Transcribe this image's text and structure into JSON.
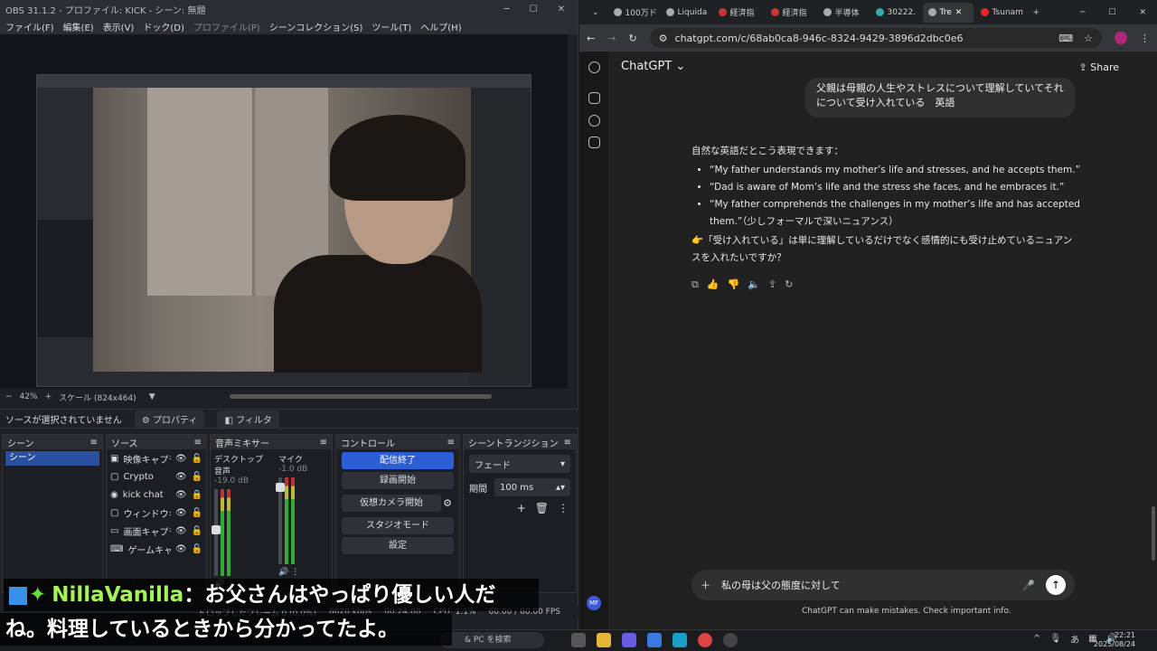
{
  "obs": {
    "title": "OBS 31.1.2 - プロファイル: KICK - シーン: 無題",
    "menu": [
      "ファイル(F)",
      "編集(E)",
      "表示(V)",
      "ドック(D)",
      "プロファイル(P)",
      "シーンコレクション(S)",
      "ツール(T)",
      "ヘルプ(H)"
    ],
    "zoom": "42%",
    "scale": "スケール (824x464)",
    "no_source": "ソースが選択されていません",
    "properties": "プロパティ",
    "filters": "フィルタ",
    "docks": {
      "scenes": {
        "title": "シーン",
        "items": [
          "シーン"
        ]
      },
      "sources": {
        "title": "ソース",
        "items": [
          "映像キャプチャ",
          "Crypto",
          "kick chat",
          "ウィンドウキャプ",
          "画面キャプチャ",
          "ゲームキャプチャ"
        ]
      },
      "mixer": {
        "title": "音声ミキサー",
        "channels": [
          {
            "name": "デスクトップ音声",
            "db": "-19.0 dB"
          },
          {
            "name": "マイク",
            "db": "-1.0 dB"
          }
        ]
      },
      "controls": {
        "title": "コントロール",
        "buttons": [
          "配信終了",
          "録画開始",
          "仮想カメラ開始",
          "スタジオモード",
          "設定"
        ]
      },
      "transitions": {
        "title": "シーントランジション",
        "type": "フェード",
        "duration_label": "期間",
        "duration": "100 ms"
      }
    },
    "status": {
      "dropped": "ドロップしたフレーム 0 (0.0%)",
      "kbps": "8620 kbps",
      "time": "00:24:08",
      "cpu": "CPU: 1.1%",
      "fps": "60.00 / 60.00 FPS"
    }
  },
  "chat_overlay": {
    "nick": "NillaVanilla",
    "line1": "：お父さんはやっぱり優しい人だ",
    "line2": "ね。料理しているときから分かってたよ。"
  },
  "browser": {
    "tabs": [
      "100万ド",
      "Liquida",
      "経済指",
      "経済指",
      "半導体",
      "30222.",
      "Tre",
      "Tsunam"
    ],
    "url": "chatgpt.com/c/68ab0ca8-946c-8324-9429-3896d2dbc0e6"
  },
  "chatgpt": {
    "model": "ChatGPT",
    "share": "Share",
    "user_message": "父親は母親の人生やストレスについて理解していてそれについて受け入れている　英語",
    "answer_intro": "自然な英語だとこう表現できます：",
    "answer_items": [
      "“My father understands my mother’s life and stresses, and he accepts them.”",
      "“Dad is aware of Mom’s life and the stress she faces, and he embraces it.”",
      "“My father comprehends the challenges in my mother’s life and has accepted them.”（少しフォーマルで深いニュアンス）"
    ],
    "answer_followup": "👉「受け入れている」は単に理解しているだけでなく感情的にも受け止めているニュアンスを入れたいですか？",
    "composer_text": "私の母は父の態度に対して",
    "disclaimer": "ChatGPT can make mistakes. Check important info.",
    "avatar": "MF"
  },
  "taskbar": {
    "search": "& PC を検索",
    "time": "22:21",
    "date": "2025/08/24",
    "ime": "あ"
  }
}
